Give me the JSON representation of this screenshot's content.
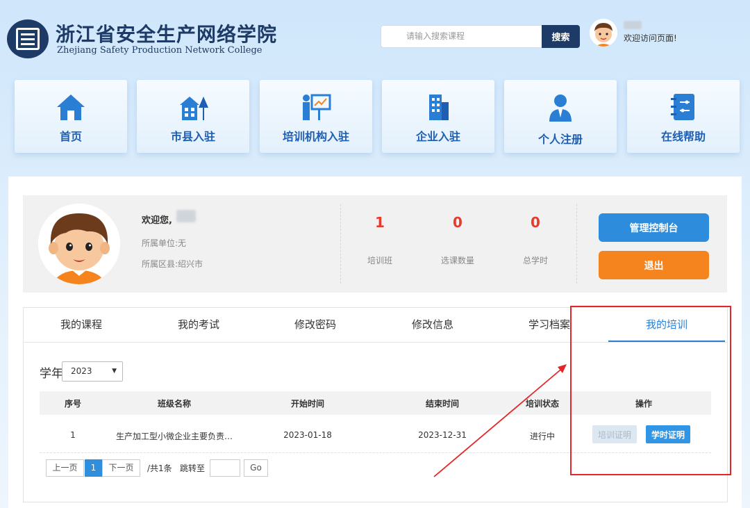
{
  "header": {
    "title_cn": "浙江省安全生产网络学院",
    "title_en": "Zhejiang Safety Production Network College",
    "search_placeholder": "请输入搜索课程",
    "search_button": "搜索",
    "welcome_top": "欢迎访问页面!"
  },
  "nav": [
    {
      "label": "首页",
      "icon": "home-icon"
    },
    {
      "label": "市县入驻",
      "icon": "city-building-icon"
    },
    {
      "label": "培训机构入驻",
      "icon": "presentation-icon"
    },
    {
      "label": "企业入驻",
      "icon": "office-building-icon"
    },
    {
      "label": "个人注册",
      "icon": "user-icon"
    },
    {
      "label": "在线帮助",
      "icon": "help-notebook-icon"
    }
  ],
  "profile": {
    "welcome": "欢迎您,",
    "unit": "所属单位:无",
    "district": "所属区县:绍兴市",
    "stats": [
      {
        "value": "1",
        "label": "培训班"
      },
      {
        "value": "0",
        "label": "选课数量"
      },
      {
        "value": "0",
        "label": "总学时"
      }
    ],
    "console_button": "管理控制台",
    "logout_button": "退出"
  },
  "tabs": [
    "我的课程",
    "我的考试",
    "修改密码",
    "修改信息",
    "学习档案",
    "我的培训"
  ],
  "active_tab": "我的培训",
  "filter": {
    "label": "学年",
    "selected": "2023"
  },
  "table": {
    "headers": [
      "序号",
      "班级名称",
      "开始时间",
      "结束时间",
      "培训状态",
      "操作"
    ],
    "rows": [
      {
        "index": "1",
        "name": "生产加工型小微企业主要负责…",
        "start": "2023-01-18",
        "end": "2023-12-31",
        "status": "进行中",
        "actions": [
          "培训证明",
          "学时证明"
        ]
      }
    ]
  },
  "pagination": {
    "prev": "上一页",
    "current": "1",
    "next": "下一页",
    "total": "/共1条",
    "jump_label": "跳转至",
    "go": "Go"
  },
  "colors": {
    "brand": "#1e3a66",
    "accent": "#2a7fd4",
    "danger": "#e4262a",
    "orange": "#f5841f"
  }
}
